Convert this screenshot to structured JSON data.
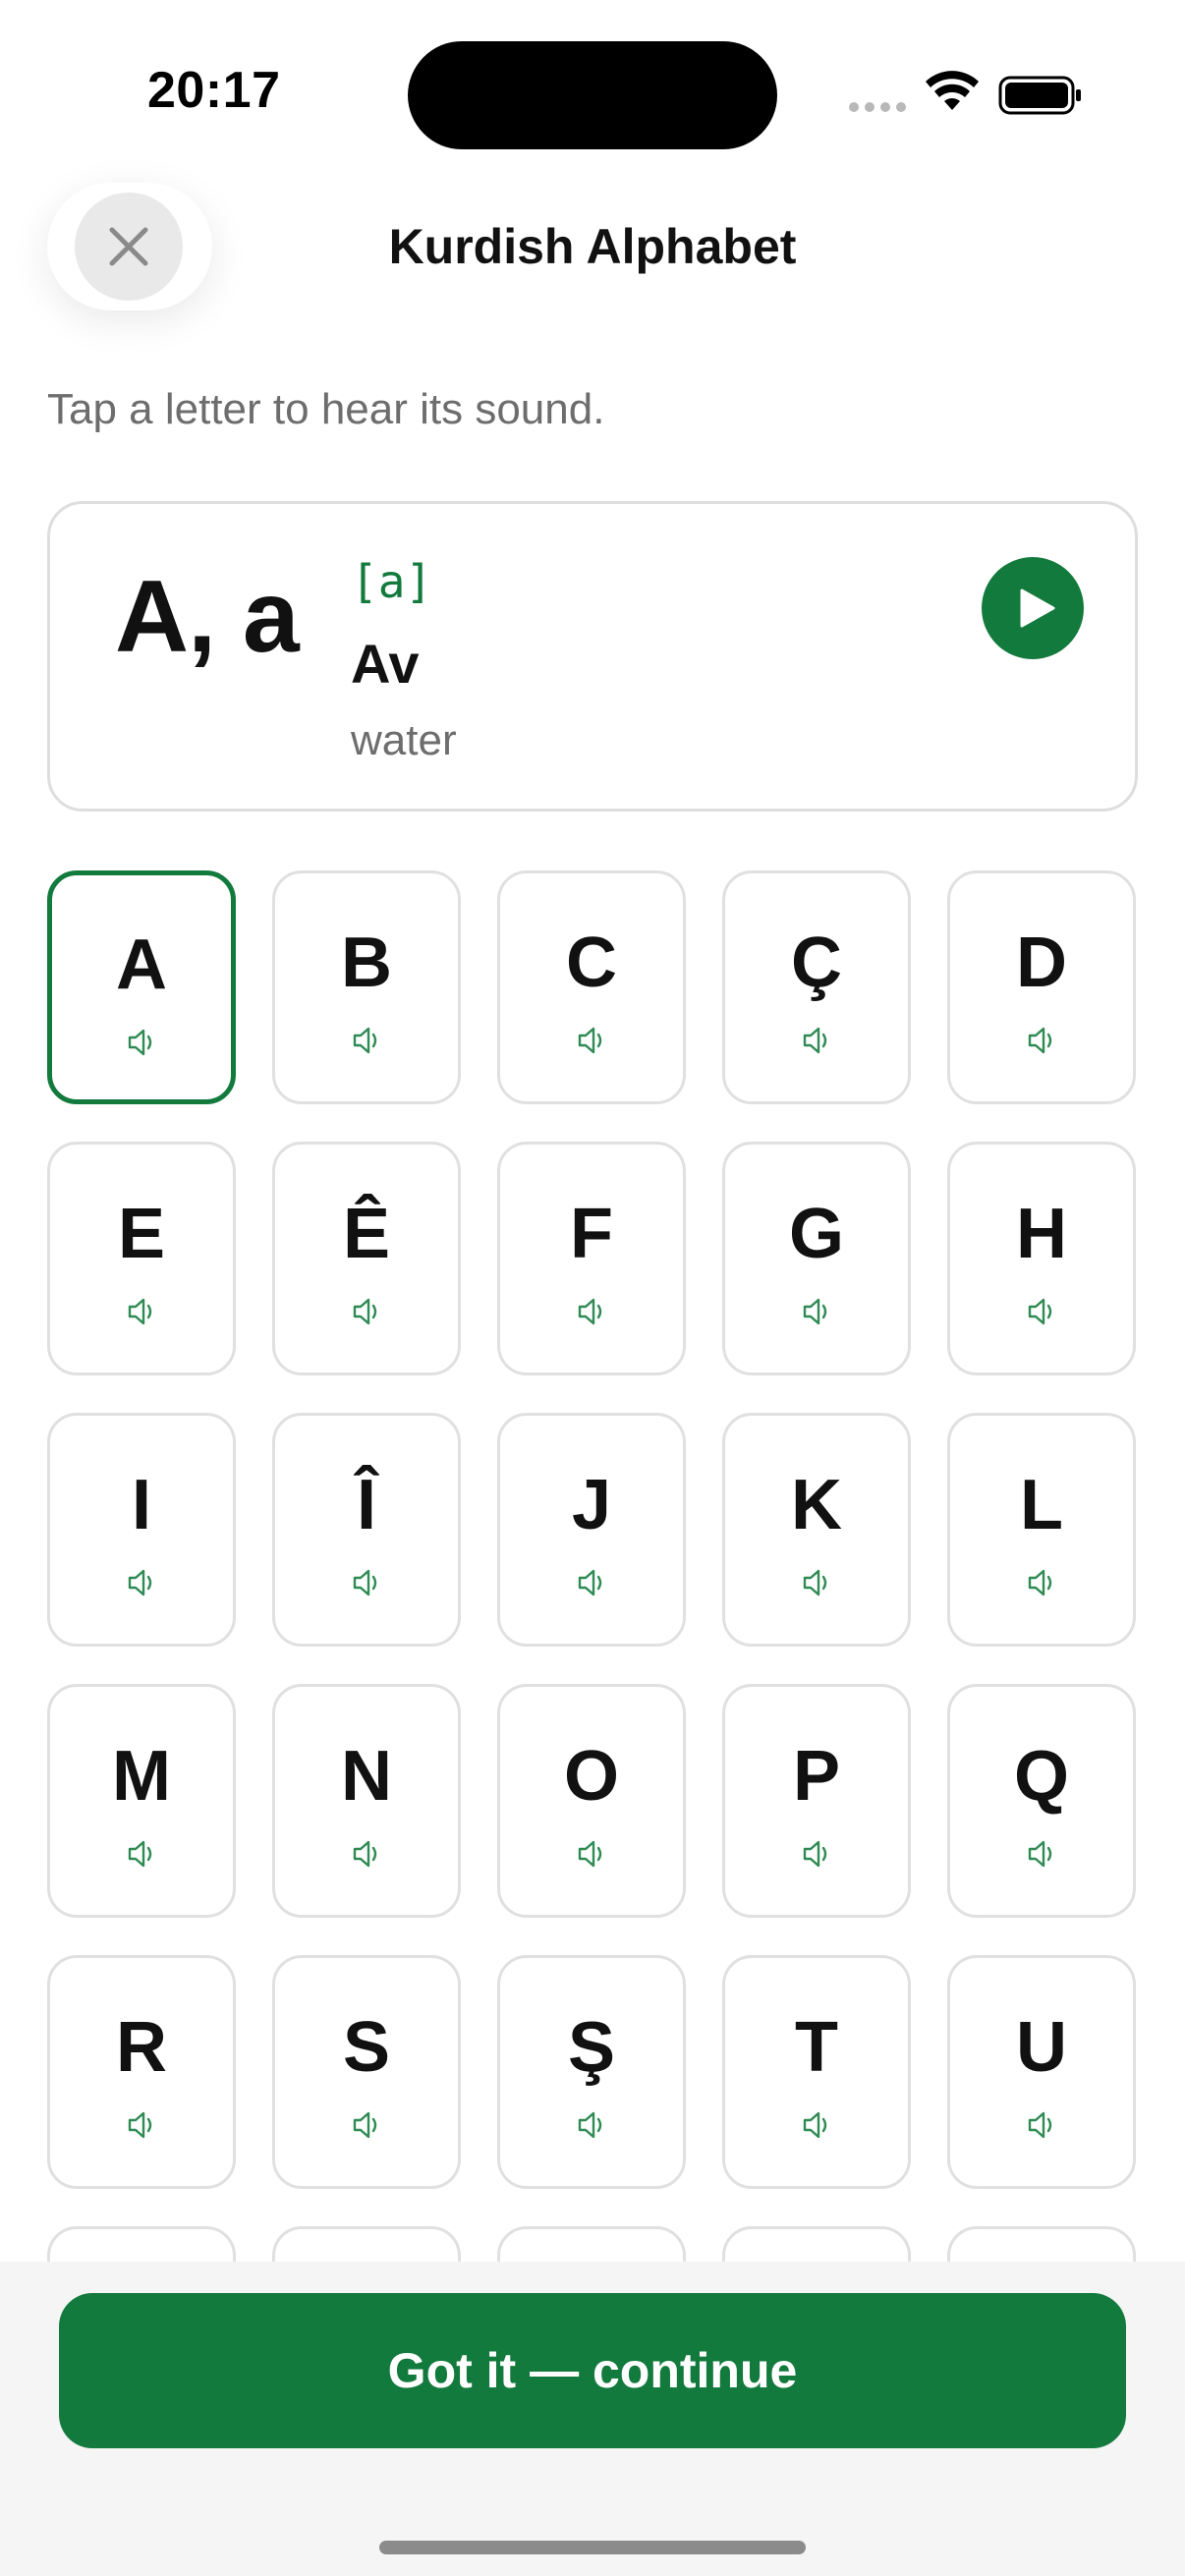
{
  "status_bar": {
    "time": "20:17"
  },
  "header": {
    "title": "Kurdish Alphabet",
    "close_icon": "close-icon"
  },
  "hint": "Tap a letter to hear its sound.",
  "featured": {
    "letter": "A, a",
    "ipa": "[a]",
    "word": "Av",
    "meaning": "water",
    "play_icon": "play-icon"
  },
  "letters": [
    "A",
    "B",
    "C",
    "Ç",
    "D",
    "E",
    "Ê",
    "F",
    "G",
    "H",
    "I",
    "Î",
    "J",
    "K",
    "L",
    "M",
    "N",
    "O",
    "P",
    "Q",
    "R",
    "S",
    "Ş",
    "T",
    "U",
    "",
    "",
    "",
    "",
    ""
  ],
  "selected_letter": "A",
  "continue_label": "Got it — continue",
  "colors": {
    "accent": "#137a3d",
    "border": "#e0e0e0",
    "muted_text": "#6d6d6d"
  }
}
